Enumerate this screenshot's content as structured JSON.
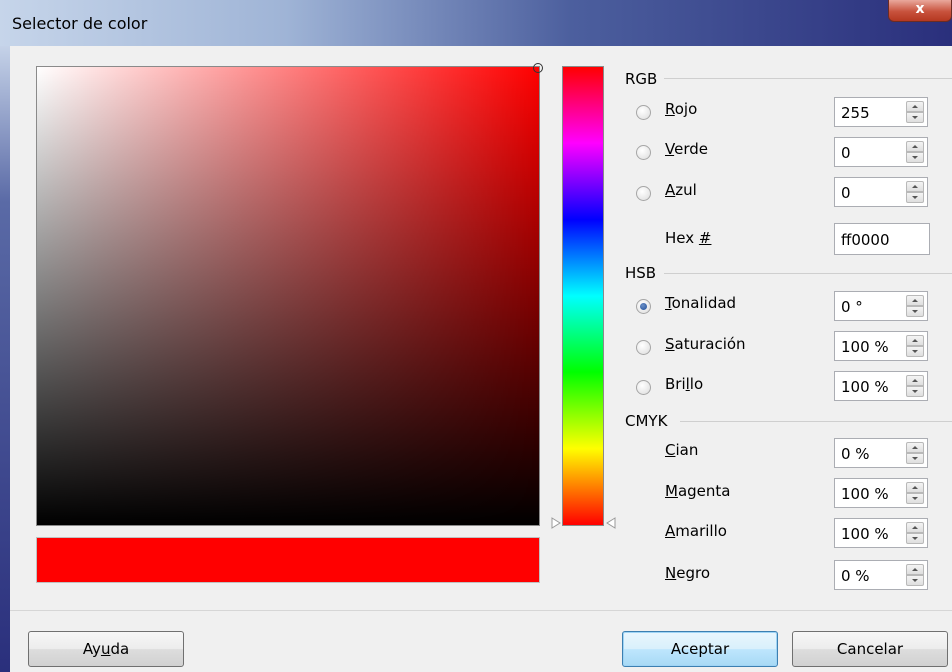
{
  "window": {
    "title": "Selector de color",
    "close_glyph": "x"
  },
  "color": {
    "hex": "#ff0000",
    "hue_deg": 0,
    "saturation": 1.0,
    "brightness": 1.0
  },
  "rgb": {
    "section": "RGB",
    "rojo": {
      "label": "Rojo",
      "underline": "R",
      "rest": "ojo",
      "value": "255"
    },
    "verde": {
      "label": "Verde",
      "underline": "V",
      "rest": "erde",
      "value": "0"
    },
    "azul": {
      "label": "Azul",
      "underline": "A",
      "rest": "zul",
      "value": "0"
    },
    "hex": {
      "label": "Hex #",
      "prefix": "Hex ",
      "underline": "#",
      "value": "ff0000"
    }
  },
  "hsb": {
    "section": "HSB",
    "tonalidad": {
      "label": "Tonalidad",
      "underline": "T",
      "rest": "onalidad",
      "value": "0 °",
      "selected": true
    },
    "saturacion": {
      "label": "Saturación",
      "underline": "S",
      "rest": "aturación",
      "value": "100 %",
      "selected": false
    },
    "brillo": {
      "label": "Brillo",
      "prefix": "Bri",
      "underline": "l",
      "rest": "lo",
      "value": "100 %",
      "selected": false
    }
  },
  "cmyk": {
    "section": "CMYK",
    "cian": {
      "label": "Cian",
      "underline": "C",
      "rest": "ian",
      "value": "0 %"
    },
    "magenta": {
      "label": "Magenta",
      "underline": "M",
      "rest": "agenta",
      "value": "100 %"
    },
    "amarillo": {
      "label": "Amarillo",
      "underline": "A",
      "rest": "marillo",
      "value": "100 %"
    },
    "negro": {
      "label": "Negro",
      "underline": "N",
      "rest": "egro",
      "value": "0 %"
    }
  },
  "buttons": {
    "help": {
      "label": "Ayuda",
      "prefix": "Ay",
      "underline": "u",
      "rest": "da"
    },
    "ok": {
      "label": "Aceptar"
    },
    "cancel": {
      "label": "Cancelar"
    }
  }
}
